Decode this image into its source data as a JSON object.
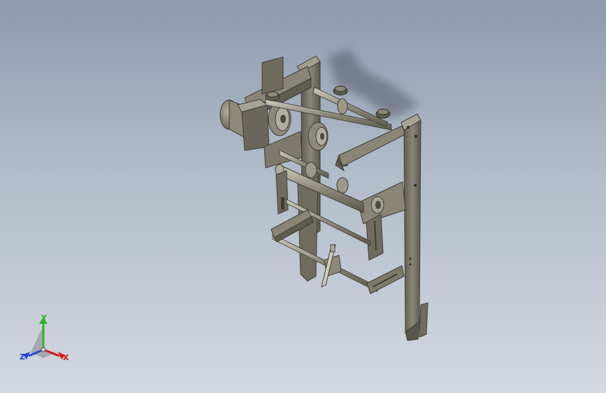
{
  "triad": {
    "x_label": "X",
    "y_label": "Y",
    "z_label": "Z",
    "x_color": "#d11a1a",
    "y_color": "#2bb32b",
    "z_color": "#2747d1"
  },
  "model": {
    "part_color": "#7e7a6b",
    "part_dark": "#4a483f",
    "part_light": "#a8a595",
    "background_top": "#8e9aae",
    "background_bottom": "#d3d8e0"
  }
}
